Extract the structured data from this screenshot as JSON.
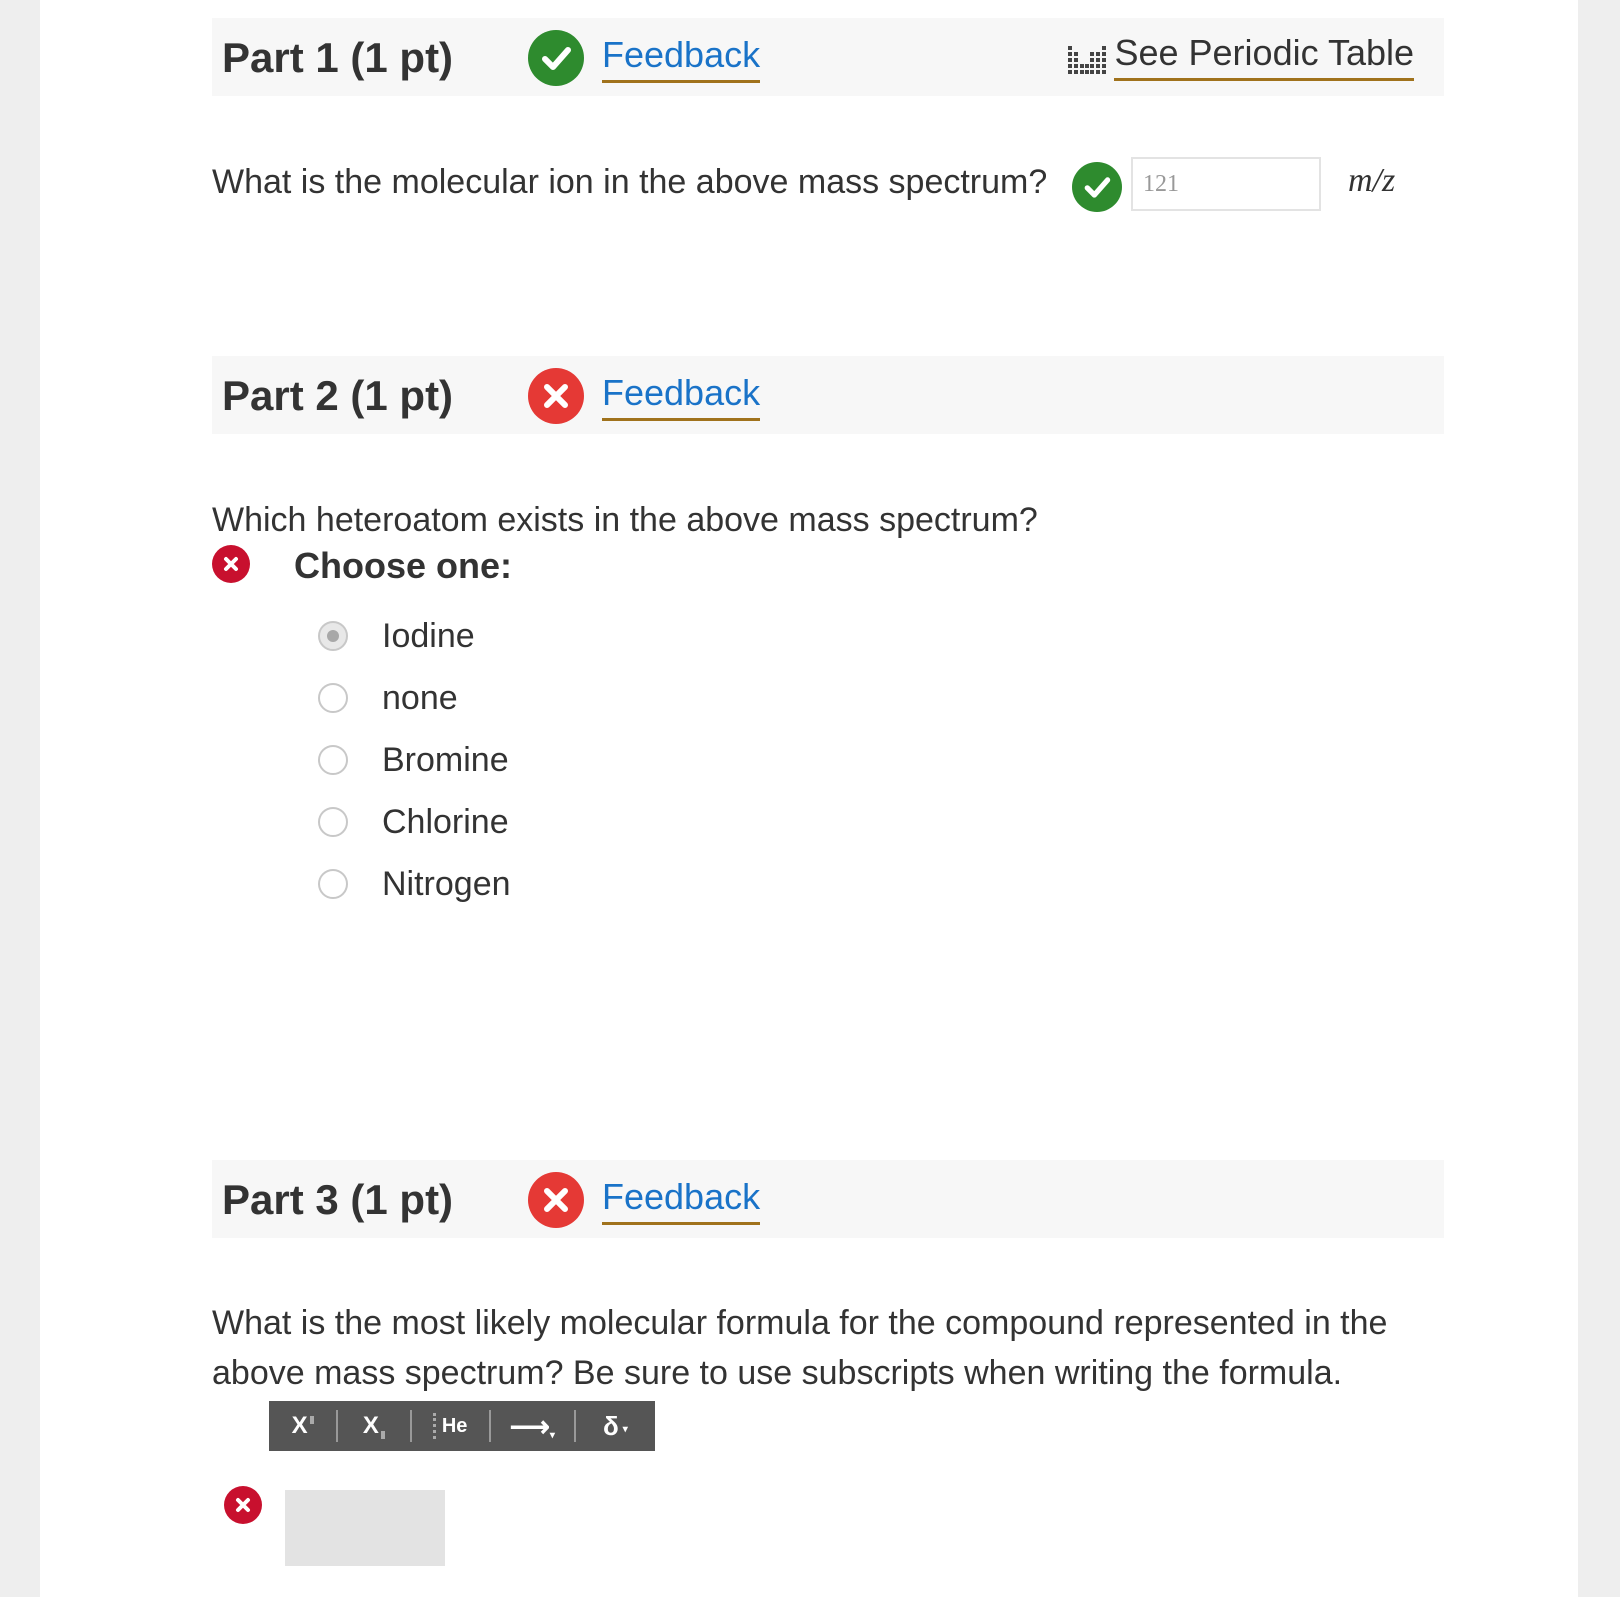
{
  "part1": {
    "title": "Part 1 (1 pt)",
    "feedback_label": "Feedback",
    "periodic_label": "See Periodic Table",
    "status": "correct",
    "question": "What is the molecular ion in the above mass spectrum?",
    "answer_value": "121",
    "unit": "m/z"
  },
  "part2": {
    "title": "Part 2 (1 pt)",
    "feedback_label": "Feedback",
    "status": "incorrect",
    "question": "Which heteroatom exists in the above mass spectrum?",
    "choose_label": "Choose one:",
    "options": [
      "Iodine",
      "none",
      "Bromine",
      "Chlorine",
      "Nitrogen"
    ],
    "selected": "Iodine"
  },
  "part3": {
    "title": "Part 3 (1 pt)",
    "feedback_label": "Feedback",
    "status": "incorrect",
    "question": "What is the most likely molecular formula for the compound represented in the above mass spectrum? Be sure to use subscripts when writing the formula.",
    "toolbar": {
      "superscript": "X",
      "subscript": "X",
      "element": "He",
      "arrow": "⟶",
      "delta": "δ"
    }
  },
  "colors": {
    "link": "#1a73c8",
    "link_underline": "#a0721c",
    "correct": "#2e8b2e",
    "incorrect": "#e53935"
  }
}
